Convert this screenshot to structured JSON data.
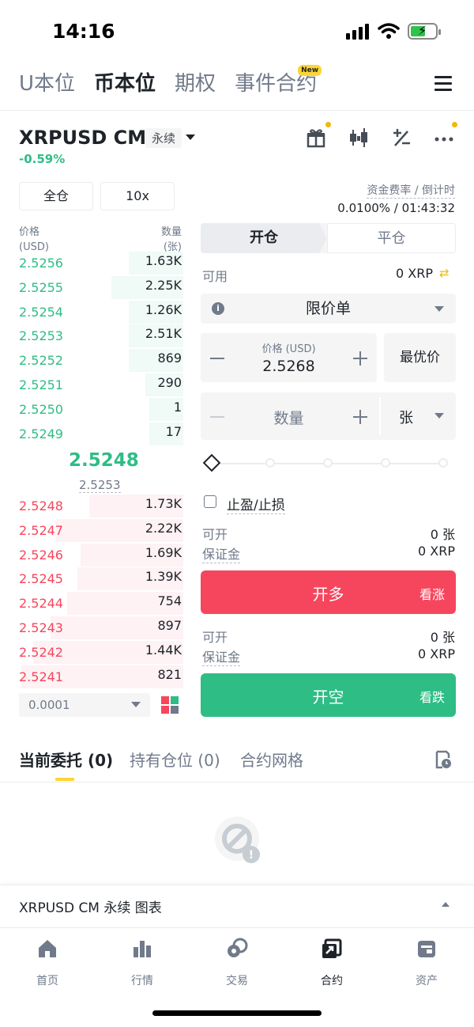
{
  "status_bar": {
    "time": "14:16"
  },
  "top_tabs": [
    {
      "label": "U本位",
      "active": false
    },
    {
      "label": "币本位",
      "active": true
    },
    {
      "label": "期权",
      "active": false
    },
    {
      "label": "事件合约",
      "active": false,
      "badge": "New"
    }
  ],
  "symbol": {
    "name": "XRPUSD CM",
    "type": "永续",
    "change": "-0.59%"
  },
  "header_icons": [
    "gift-icon",
    "candlestick-icon",
    "calculator-icon",
    "more-icon"
  ],
  "margin_mode": "全仓",
  "leverage": "10x",
  "funding": {
    "label": "资金费率 / 倒计时",
    "value": "0.0100% / 01:43:32"
  },
  "orderbook": {
    "price_header": "价格",
    "price_unit": "(USD)",
    "qty_header": "数量",
    "qty_unit": "(张)",
    "asks": [
      {
        "price": "2.5256",
        "qty": "1.63K",
        "depth": 0.32
      },
      {
        "price": "2.5255",
        "qty": "2.25K",
        "depth": 0.42
      },
      {
        "price": "2.5254",
        "qty": "1.26K",
        "depth": 0.32
      },
      {
        "price": "2.5253",
        "qty": "2.51K",
        "depth": 0.32
      },
      {
        "price": "2.5252",
        "qty": "869",
        "depth": 0.32
      },
      {
        "price": "2.5251",
        "qty": "290",
        "depth": 0.22
      },
      {
        "price": "2.5250",
        "qty": "1",
        "depth": 0.2
      },
      {
        "price": "2.5249",
        "qty": "17",
        "depth": 0.2
      }
    ],
    "last_price": "2.5248",
    "mark_price": "2.5253",
    "bids": [
      {
        "price": "2.5248",
        "qty": "1.73K",
        "depth": 0.55
      },
      {
        "price": "2.5247",
        "qty": "2.22K",
        "depth": 0.75
      },
      {
        "price": "2.5246",
        "qty": "1.69K",
        "depth": 0.6
      },
      {
        "price": "2.5245",
        "qty": "1.39K",
        "depth": 0.62
      },
      {
        "price": "2.5244",
        "qty": "754",
        "depth": 0.68
      },
      {
        "price": "2.5243",
        "qty": "897",
        "depth": 0.78
      },
      {
        "price": "2.5242",
        "qty": "1.44K",
        "depth": 0.88
      },
      {
        "price": "2.5241",
        "qty": "821",
        "depth": 0.95
      }
    ],
    "precision": "0.0001"
  },
  "order_form": {
    "open_tab": "开仓",
    "close_tab": "平仓",
    "available_label": "可用",
    "available_value": "0 XRP",
    "order_type": "限价单",
    "price_label": "价格 (USD)",
    "price_value": "2.5268",
    "best_price": "最优价",
    "qty_placeholder": "数量",
    "qty_unit": "张",
    "tpsl_label": "止盈/止损",
    "long": {
      "can_open_label": "可开",
      "can_open_value": "0 张",
      "margin_label": "保证金",
      "margin_value": "0 XRP",
      "button": "开多",
      "button_sub": "看涨"
    },
    "short": {
      "can_open_label": "可开",
      "can_open_value": "0 张",
      "margin_label": "保证金",
      "margin_value": "0 XRP",
      "button": "开空",
      "button_sub": "看跌"
    }
  },
  "bottom_tabs": [
    {
      "label": "当前委托 (0)",
      "active": true
    },
    {
      "label": "持有仓位 (0)",
      "active": false
    },
    {
      "label": "合约网格",
      "active": false
    }
  ],
  "chart_bar": {
    "label": "XRPUSD CM 永续  图表"
  },
  "nav": [
    {
      "label": "首页",
      "icon": "home-icon",
      "active": false
    },
    {
      "label": "行情",
      "icon": "market-icon",
      "active": false
    },
    {
      "label": "交易",
      "icon": "trade-icon",
      "active": false
    },
    {
      "label": "合约",
      "icon": "futures-icon",
      "active": true
    },
    {
      "label": "资产",
      "icon": "wallet-icon",
      "active": false
    }
  ],
  "colors": {
    "green": "#2ebd85",
    "red": "#f6465d",
    "yellow": "#fcd535"
  }
}
